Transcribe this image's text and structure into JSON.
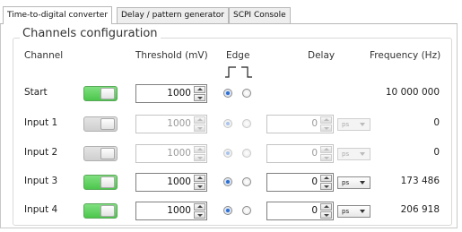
{
  "tabs": [
    {
      "label": "Time-to-digital converter",
      "active": true
    },
    {
      "label": "Delay / pattern generator",
      "active": false
    },
    {
      "label": "SCPI Console",
      "active": false
    }
  ],
  "group_title": "Channels configuration",
  "headers": {
    "channel": "Channel",
    "threshold": "Threshold (mV)",
    "edge": "Edge",
    "delay": "Delay",
    "frequency": "Frequency (Hz)"
  },
  "channels": [
    {
      "name": "Start",
      "enabled": true,
      "threshold": "1000",
      "edge": "rising",
      "delay": "",
      "unit": "",
      "frequency": "10 000 000"
    },
    {
      "name": "Input 1",
      "enabled": false,
      "threshold": "1000",
      "edge": "rising",
      "delay": "0",
      "unit": "ps",
      "frequency": "0"
    },
    {
      "name": "Input 2",
      "enabled": false,
      "threshold": "1000",
      "edge": "rising",
      "delay": "0",
      "unit": "ps",
      "frequency": "0"
    },
    {
      "name": "Input 3",
      "enabled": true,
      "threshold": "1000",
      "edge": "rising",
      "delay": "0",
      "unit": "ps",
      "frequency": "173 486"
    },
    {
      "name": "Input 4",
      "enabled": true,
      "threshold": "1000",
      "edge": "rising",
      "delay": "0",
      "unit": "ps",
      "frequency": "206 918"
    }
  ],
  "colors": {
    "toggle_on": "#5fd35f",
    "toggle_off": "#d8d8d8",
    "radio_selected": "#2e6fd0"
  },
  "icons": {
    "edge_rising": "rising-edge-icon",
    "edge_falling": "falling-edge-icon"
  }
}
